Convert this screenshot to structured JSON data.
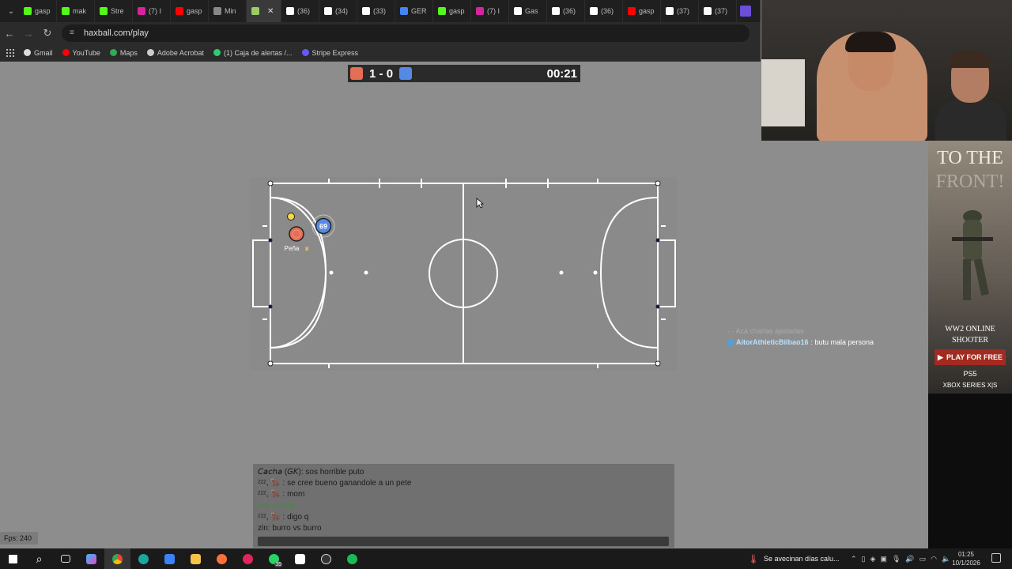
{
  "browser": {
    "tabs": [
      {
        "label": "gasp",
        "icon": "kick-icon",
        "color": "#53fc18"
      },
      {
        "label": "mak",
        "icon": "kick-icon",
        "color": "#53fc18"
      },
      {
        "label": "Stre",
        "icon": "kick-icon",
        "color": "#53fc18"
      },
      {
        "label": "(7) I",
        "icon": "instagram-icon",
        "color": "#d6249f"
      },
      {
        "label": "gasp",
        "icon": "youtube-icon",
        "color": "#ff0000"
      },
      {
        "label": "Min",
        "icon": "web-icon",
        "color": "#888888"
      },
      {
        "label": "",
        "icon": "haxball-icon",
        "color": "#9ccc65",
        "active": true
      },
      {
        "label": "(36)",
        "icon": "tiktok-icon",
        "color": "#ffffff"
      },
      {
        "label": "(34)",
        "icon": "tiktok-icon",
        "color": "#ffffff"
      },
      {
        "label": "(33)",
        "icon": "tiktok-icon",
        "color": "#ffffff"
      },
      {
        "label": "GER",
        "icon": "google-icon",
        "color": "#4285f4"
      },
      {
        "label": "gasp",
        "icon": "kick-icon",
        "color": "#53fc18"
      },
      {
        "label": "(7) I",
        "icon": "instagram-icon",
        "color": "#d6249f"
      },
      {
        "label": "Gas",
        "icon": "x-icon",
        "color": "#ffffff"
      },
      {
        "label": "(36)",
        "icon": "tiktok-icon",
        "color": "#ffffff"
      },
      {
        "label": "(36)",
        "icon": "tiktok-icon",
        "color": "#ffffff"
      },
      {
        "label": "gasp",
        "icon": "youtube-icon",
        "color": "#ff0000"
      },
      {
        "label": "(37)",
        "icon": "tiktok-icon",
        "color": "#ffffff"
      },
      {
        "label": "(37)",
        "icon": "tiktok-icon",
        "color": "#ffffff"
      }
    ],
    "url": "haxball.com/play",
    "bookmarks": [
      {
        "label": "Gmail",
        "color": "#dddddd"
      },
      {
        "label": "YouTube",
        "color": "#ff0000"
      },
      {
        "label": "Maps",
        "color": "#34a853"
      },
      {
        "label": "Adobe Acrobat",
        "color": "#cccccc"
      },
      {
        "label": "(1) Caja de alertas /...",
        "color": "#2ecc71"
      },
      {
        "label": "Stripe Express",
        "color": "#635bff"
      }
    ]
  },
  "game": {
    "score_red": "1",
    "score_sep": "-",
    "score_blue": "0",
    "timer": "00:21",
    "red_color": "#e56e56",
    "blue_color": "#5689e5",
    "blue_player_number": "69",
    "red_player_name": "Peña",
    "fps": "Fps: 240"
  },
  "stream_chat": {
    "faded": "· ·   Acá charlas ajedadas",
    "user": "AitorAthleticBilbao16",
    "message": ": butu mala persona"
  },
  "game_chat": [
    {
      "text": "𝘊𝘢𝘤𝘩𝘢 (𝘎𝘒): sos horrible puto",
      "type": "msg"
    },
    {
      "text": "ᶻᶻᶻ, 🐂 : se cree bueno ganandole a un pete",
      "type": "msg"
    },
    {
      "text": "ᶻᶻᶻ, 🐂 : mom",
      "type": "msg"
    },
    {
      "text": "has joined",
      "type": "join"
    },
    {
      "text": "ᶻᶻᶻ, 🐂 : digo q",
      "type": "msg"
    },
    {
      "text": "zin: burro vs burro",
      "type": "msg"
    }
  ],
  "ad": {
    "title": "TO THE",
    "title2": "FRONT!",
    "sub1": "WW2 ONLINE",
    "sub2": "SHOOTER",
    "button": "PLAY FOR FREE",
    "ps": "PS5",
    "xbox": "XBOX SERIES X|S"
  },
  "taskbar": {
    "news": "Se avecinan días calu...",
    "time": "01:25",
    "date": "10/1/2026",
    "whatsapp_badge": "35"
  }
}
